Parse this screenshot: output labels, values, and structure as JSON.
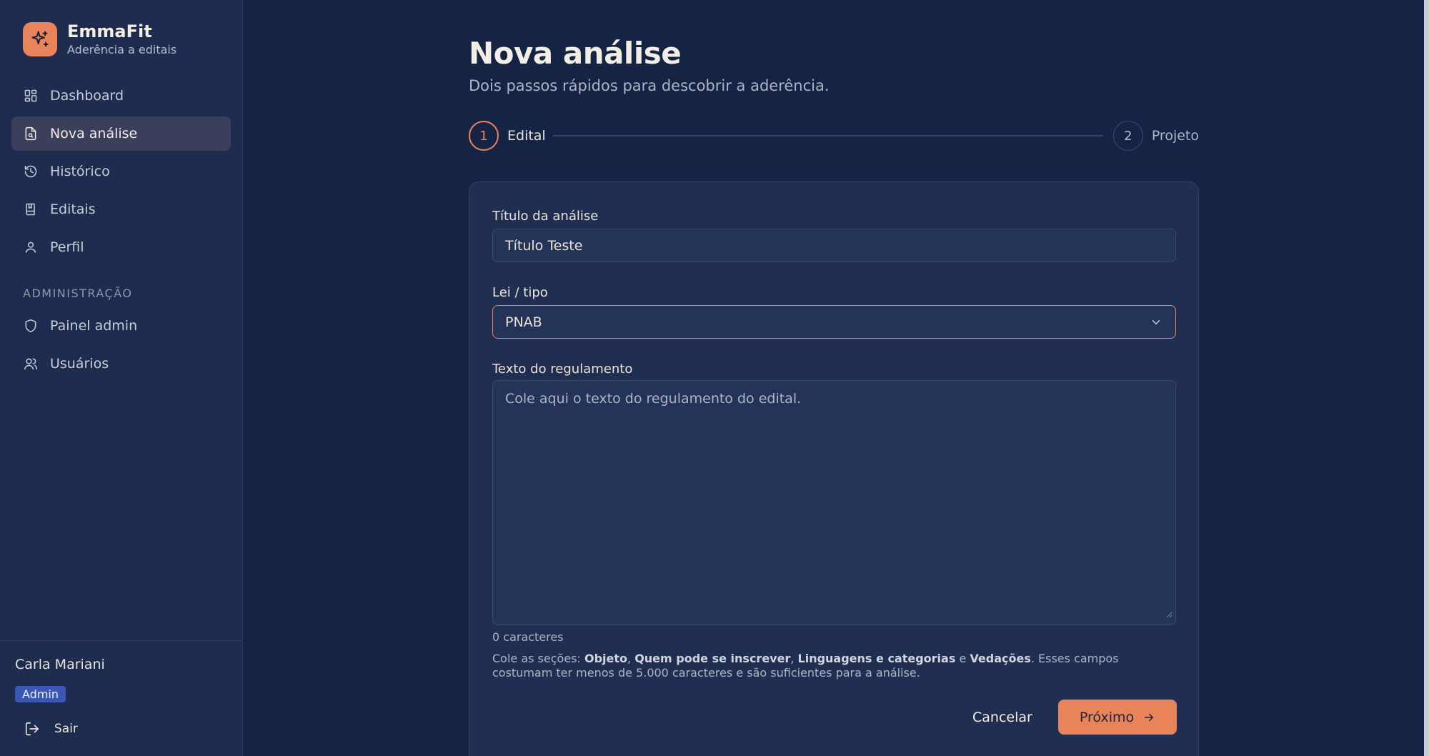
{
  "brand": {
    "name": "EmmaFit",
    "subtitle": "Aderência a editais"
  },
  "nav": {
    "items": [
      {
        "label": "Dashboard",
        "icon": "dashboard-icon"
      },
      {
        "label": "Nova análise",
        "icon": "file-search-icon",
        "active": true
      },
      {
        "label": "Histórico",
        "icon": "history-icon"
      },
      {
        "label": "Editais",
        "icon": "book-icon"
      },
      {
        "label": "Perfil",
        "icon": "user-icon"
      }
    ],
    "admin_section": "ADMINISTRAÇÃO",
    "admin_items": [
      {
        "label": "Painel admin",
        "icon": "shield-icon"
      },
      {
        "label": "Usuários",
        "icon": "users-icon"
      }
    ]
  },
  "user": {
    "name": "Carla Mariani",
    "role": "Admin",
    "logout": "Sair"
  },
  "page": {
    "title": "Nova análise",
    "subtitle": "Dois passos rápidos para descobrir a aderência."
  },
  "stepper": {
    "steps": [
      {
        "number": "1",
        "label": "Edital",
        "active": true
      },
      {
        "number": "2",
        "label": "Projeto",
        "active": false
      }
    ]
  },
  "form": {
    "title_label": "Título da análise",
    "title_value": "Título Teste",
    "law_label": "Lei / tipo",
    "law_value": "PNAB",
    "text_label": "Texto do regulamento",
    "text_placeholder": "Cole aqui o texto do regulamento do edital.",
    "char_count": "0 caracteres",
    "hint": {
      "prefix": "Cole as seções: ",
      "s1": "Objeto",
      "sep1": ", ",
      "s2": "Quem pode se inscrever",
      "sep2": ", ",
      "s3": "Linguagens e categorias",
      "sep3": " e ",
      "s4": "Vedações",
      "suffix": ". Esses campos costumam ter menos de 5.000 caracteres e são suficientes para a análise."
    },
    "cancel_label": "Cancelar",
    "next_label": "Próximo"
  },
  "colors": {
    "accent": "#e9845a",
    "background": "#152445",
    "sidebar": "#1e2c50",
    "card": "#202e52",
    "badge": "#3b57b5"
  }
}
